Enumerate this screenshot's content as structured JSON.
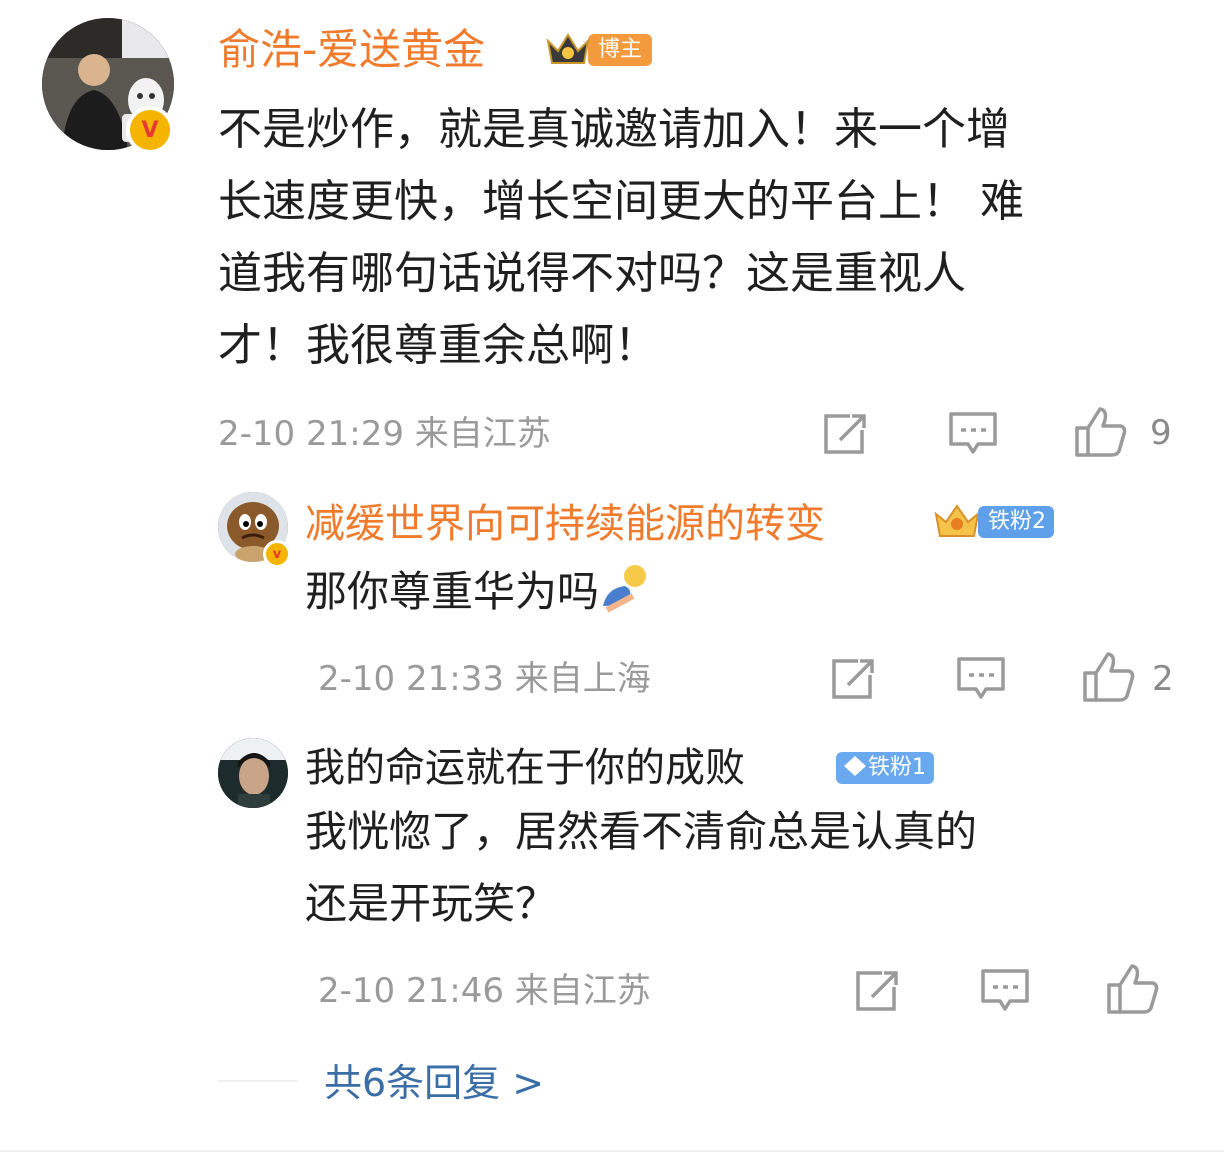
{
  "post": {
    "author": "俞浩-爱送黄金",
    "author_badge": "博主",
    "lines": [
      "不是炒作，就是真诚邀请加入！来一个增",
      "长速度更快，增长空间更大的平台上！  难",
      "道我有哪句话说得不对吗？这是重视人",
      "才！我很尊重余总啊！"
    ],
    "meta": "2-10 21:29 来自江苏",
    "likes": "9"
  },
  "replies": [
    {
      "author": "减缓世界向可持续能源的转变",
      "badge": "铁粉2",
      "lines": [
        "那你尊重华为吗"
      ],
      "meta": "2-10 21:33 来自上海",
      "likes": "2"
    },
    {
      "author": "我的命运就在于你的成败",
      "badge": "铁粉1",
      "lines": [
        "我恍惚了，居然看不清俞总是认真的",
        "还是开玩笑？"
      ],
      "meta": "2-10 21:46 来自江苏",
      "likes": ""
    }
  ],
  "more_replies": "共6条回复 >",
  "colors": {
    "name_orange": "#f07b2c",
    "link_blue": "#3a6ea5",
    "meta_gray": "#9a9a9a",
    "fan_blue": "#5ea1ea"
  },
  "icons": [
    "verified-v-icon",
    "crown-icon",
    "share-icon",
    "comment-icon",
    "like-icon",
    "sleeping-emoji-icon",
    "diamond-icon"
  ]
}
